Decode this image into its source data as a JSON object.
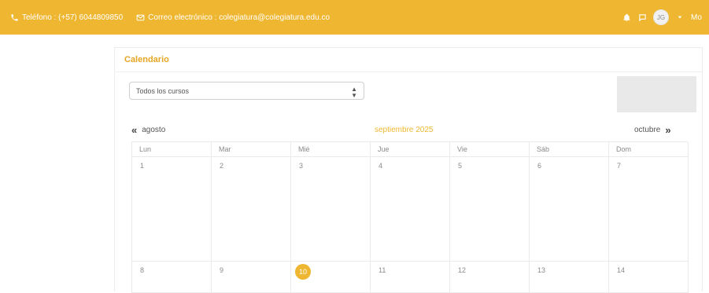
{
  "topbar": {
    "phone_text": "Teléfono : (+57) 6044809850",
    "email_text": "Correo electrónico : colegiatura@colegiatura.edu.co",
    "avatar_initials": "JG",
    "user_name_partial": "Mo",
    "icons": [
      "phone-icon",
      "envelope-icon",
      "bell-icon",
      "chat-icon",
      "chevron-down-icon"
    ]
  },
  "calendar": {
    "title": "Calendario",
    "course_filter": {
      "selected": "Todos los cursos"
    },
    "nav": {
      "prev_label": "agosto",
      "current_label": "septiembre 2025",
      "next_label": "octubre"
    },
    "weekdays": [
      "Lun",
      "Mar",
      "Mié",
      "Jue",
      "Vie",
      "Sáb",
      "Dom"
    ],
    "weeks": [
      [
        "1",
        "2",
        "3",
        "4",
        "5",
        "6",
        "7"
      ],
      [
        "8",
        "9",
        "10",
        "11",
        "12",
        "13",
        "14"
      ]
    ],
    "today": "10"
  },
  "colors": {
    "accent": "#efb731",
    "header_title": "#e6a623"
  }
}
